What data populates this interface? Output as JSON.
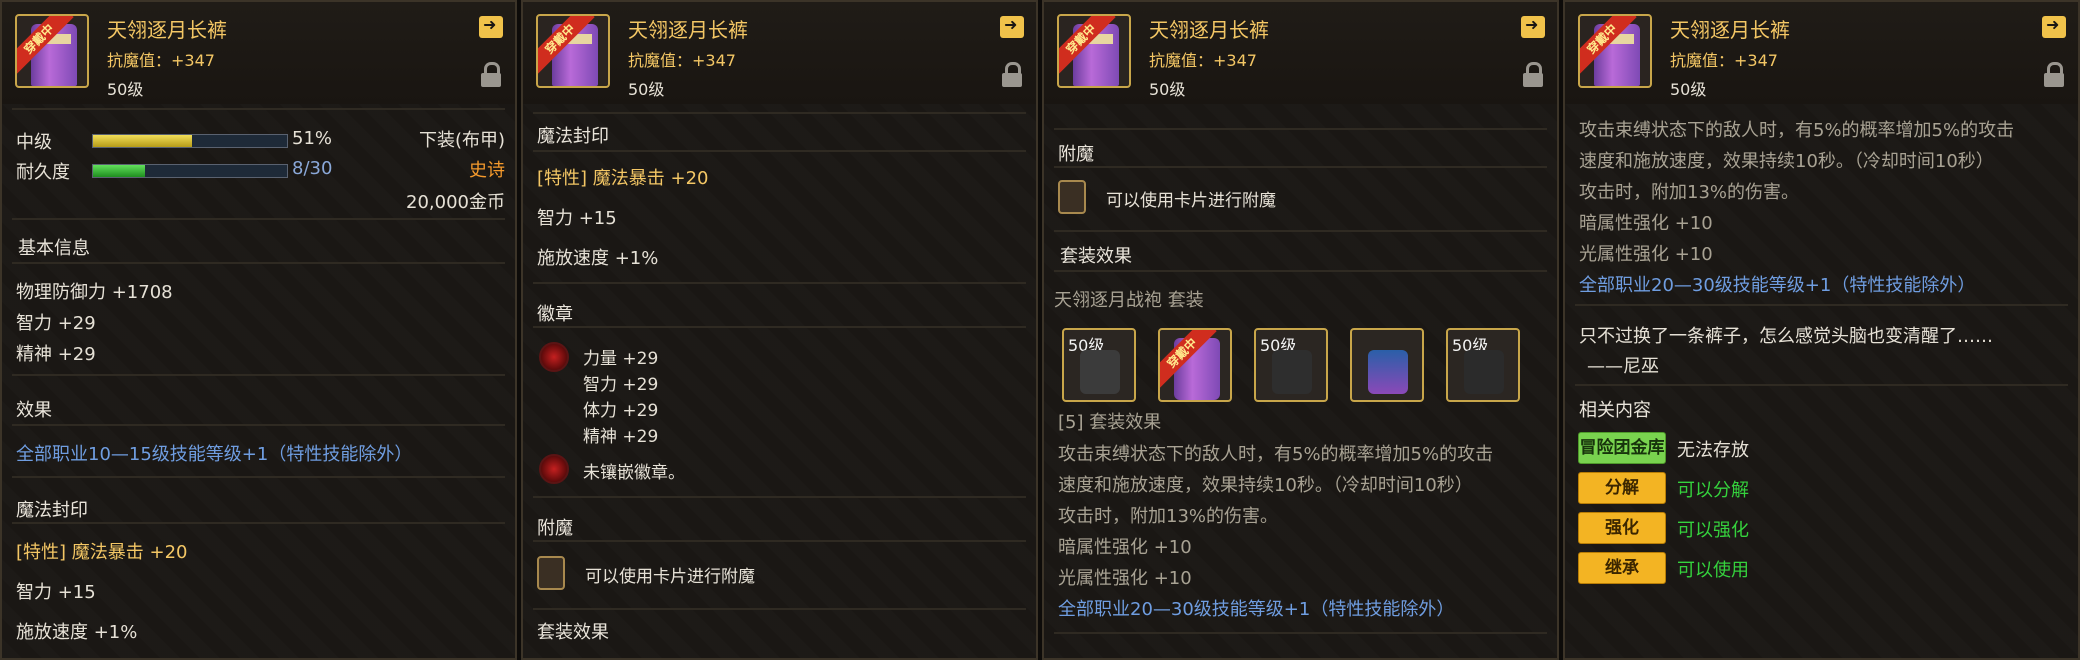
{
  "item": {
    "name": "天翎逐月长裤",
    "resist": "抗魔值：+347",
    "level": "50级",
    "tag": "穿戴中"
  },
  "panel1": {
    "grade_label": "中级",
    "grade_pct": "51%",
    "grade_value": 0.51,
    "dur_label": "耐久度",
    "dur_text": "8/30",
    "dur_value": 0.2667,
    "slot": "下装(布甲)",
    "rarity": "史诗",
    "price": "20,000金币",
    "basic_header": "基本信息",
    "basic": [
      "物理防御力 +1708",
      "智力 +29",
      "精神 +29"
    ],
    "effect_header": "效果",
    "effect": "全部职业10—15级技能等级+1（特性技能除外）",
    "seal_header": "魔法封印",
    "seal_1": "[特性] 魔法暴击 +20",
    "seal_2": "智力 +15",
    "seal_3": "施放速度 +1%"
  },
  "panel2": {
    "seal_header": "魔法封印",
    "seal_1": "[特性] 魔法暴击 +20",
    "seal_2": "智力 +15",
    "seal_3": "施放速度 +1%",
    "emblem_header": "徽章",
    "emblem_stats": [
      "力量 +29",
      "智力 +29",
      "体力 +29",
      "精神 +29"
    ],
    "emblem_empty": "未镶嵌徽章。",
    "enchant_header": "附魔",
    "enchant_text": "可以使用卡片进行附魔",
    "set_header": "套装效果"
  },
  "panel3": {
    "enchant_header": "附魔",
    "enchant_text": "可以使用卡片进行附魔",
    "set_header": "套装效果",
    "set_name": "天翎逐月战袍  套装",
    "set_items": [
      "50级",
      "",
      "50级",
      "",
      "50级"
    ],
    "set_effect_title": "[5] 套装效果",
    "set_effect_lines": [
      "攻击束缚状态下的敌人时，有5%的概率增加5%的攻击",
      "速度和施放速度，效果持续10秒。（冷却时间10秒）",
      "攻击时，附加13%的伤害。",
      "暗属性强化 +10",
      "光属性强化 +10"
    ],
    "set_skill": "全部职业20—30级技能等级+1（特性技能除外）"
  },
  "panel4": {
    "set_effect_lines": [
      "攻击束缚状态下的敌人时，有5%的概率增加5%的攻击",
      "速度和施放速度，效果持续10秒。（冷却时间10秒）",
      "攻击时，附加13%的伤害。",
      "暗属性强化 +10",
      "光属性强化 +10"
    ],
    "set_skill": "全部职业20—30级技能等级+1（特性技能除外）",
    "flavor": "只不过换了一条裤子，怎么感觉头脑也变清醒了……",
    "flavor_author": "——尼巫",
    "related_header": "相关内容",
    "rows": [
      {
        "btn": "冒险团金库",
        "text": "无法存放"
      },
      {
        "btn": "分解",
        "text": "可以分解"
      },
      {
        "btn": "强化",
        "text": "可以强化"
      },
      {
        "btn": "继承",
        "text": "可以使用"
      }
    ]
  },
  "colors": {
    "title_gold": "#f4c765",
    "link_blue": "#6f9de0",
    "epic_orange": "#f59a2c",
    "ok_green": "#35d23d"
  }
}
